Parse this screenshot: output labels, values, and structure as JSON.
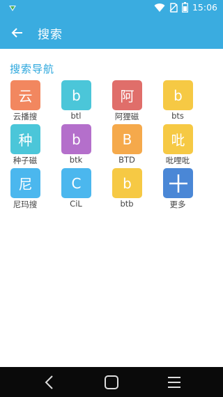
{
  "status_bar": {
    "time": "15:06",
    "accent": "#3aace0"
  },
  "toolbar": {
    "title": "搜索",
    "back_icon": "arrow-left-icon"
  },
  "section": {
    "title": "搜索导航",
    "color": "#2aa6dc"
  },
  "nav_items": [
    {
      "glyph": "云",
      "label": "云播搜",
      "color": "#f2875f"
    },
    {
      "glyph": "b",
      "label": "btl",
      "color": "#4bc6d9"
    },
    {
      "glyph": "阿",
      "label": "阿狸磁",
      "color": "#e06e6a"
    },
    {
      "glyph": "b",
      "label": "bts",
      "color": "#f6c944"
    },
    {
      "glyph": "种",
      "label": "种子磁",
      "color": "#4bc6d9"
    },
    {
      "glyph": "b",
      "label": "btk",
      "color": "#b46fcb"
    },
    {
      "glyph": "B",
      "label": "BTD",
      "color": "#f5a94b"
    },
    {
      "glyph": "吡",
      "label": "吡哩吡",
      "color": "#f6c944"
    },
    {
      "glyph": "尼",
      "label": "尼玛搜",
      "color": "#4bb7ee"
    },
    {
      "glyph": "C",
      "label": "CiL",
      "color": "#4bb7ee"
    },
    {
      "glyph": "b",
      "label": "btb",
      "color": "#f6c944"
    },
    {
      "glyph": "+",
      "label": "更多",
      "color": "#4a87d6",
      "icon": "plus-icon"
    }
  ],
  "system_nav": {
    "back_icon": "back-icon",
    "home_icon": "home-icon",
    "recents_icon": "recents-icon"
  }
}
